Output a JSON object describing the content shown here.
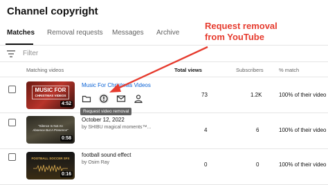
{
  "header": {
    "title": "Channel copyright"
  },
  "tabs": [
    {
      "label": "Matches",
      "active": true
    },
    {
      "label": "Removal requests",
      "active": false
    },
    {
      "label": "Messages",
      "active": false
    },
    {
      "label": "Archive",
      "active": false
    }
  ],
  "filter": {
    "placeholder": "Filter",
    "icon": "filter-icon"
  },
  "table": {
    "headers": {
      "matching": "Matching videos",
      "views": "Total views",
      "subscribers": "Subscribers",
      "match": "% match"
    },
    "rows": [
      {
        "thumb_text": "MUSIC FOR",
        "thumb_text2": "CHRISTMAS VIDEOS",
        "duration": "4:52",
        "title": "Music For Christmas Videos",
        "views": "73",
        "subscribers": "1.2K",
        "match": "100% of their video"
      },
      {
        "thumb_text": "\"Silence Is Not An",
        "thumb_text2": "Absence But A Presence\"",
        "duration": "0:58",
        "title": "October 12, 2022",
        "subtitle": "by SHIBU magical moments™...",
        "views": "4",
        "subscribers": "6",
        "match": "100% of their video"
      },
      {
        "thumb_text": "FOOTBALL SOCCER SFX",
        "thumb_text2": "",
        "duration": "0:16",
        "title": "football sound effect",
        "subtitle": "by Osim Ray",
        "views": "0",
        "subscribers": "0",
        "match": "100% of their video"
      }
    ]
  },
  "tooltip": "Request video removal",
  "annotation": {
    "line1": "Request removal",
    "line2": "from YouTube",
    "color": "#e63b2e"
  },
  "colors": {
    "link": "#065fd4",
    "accent_red": "#e63b2e"
  }
}
